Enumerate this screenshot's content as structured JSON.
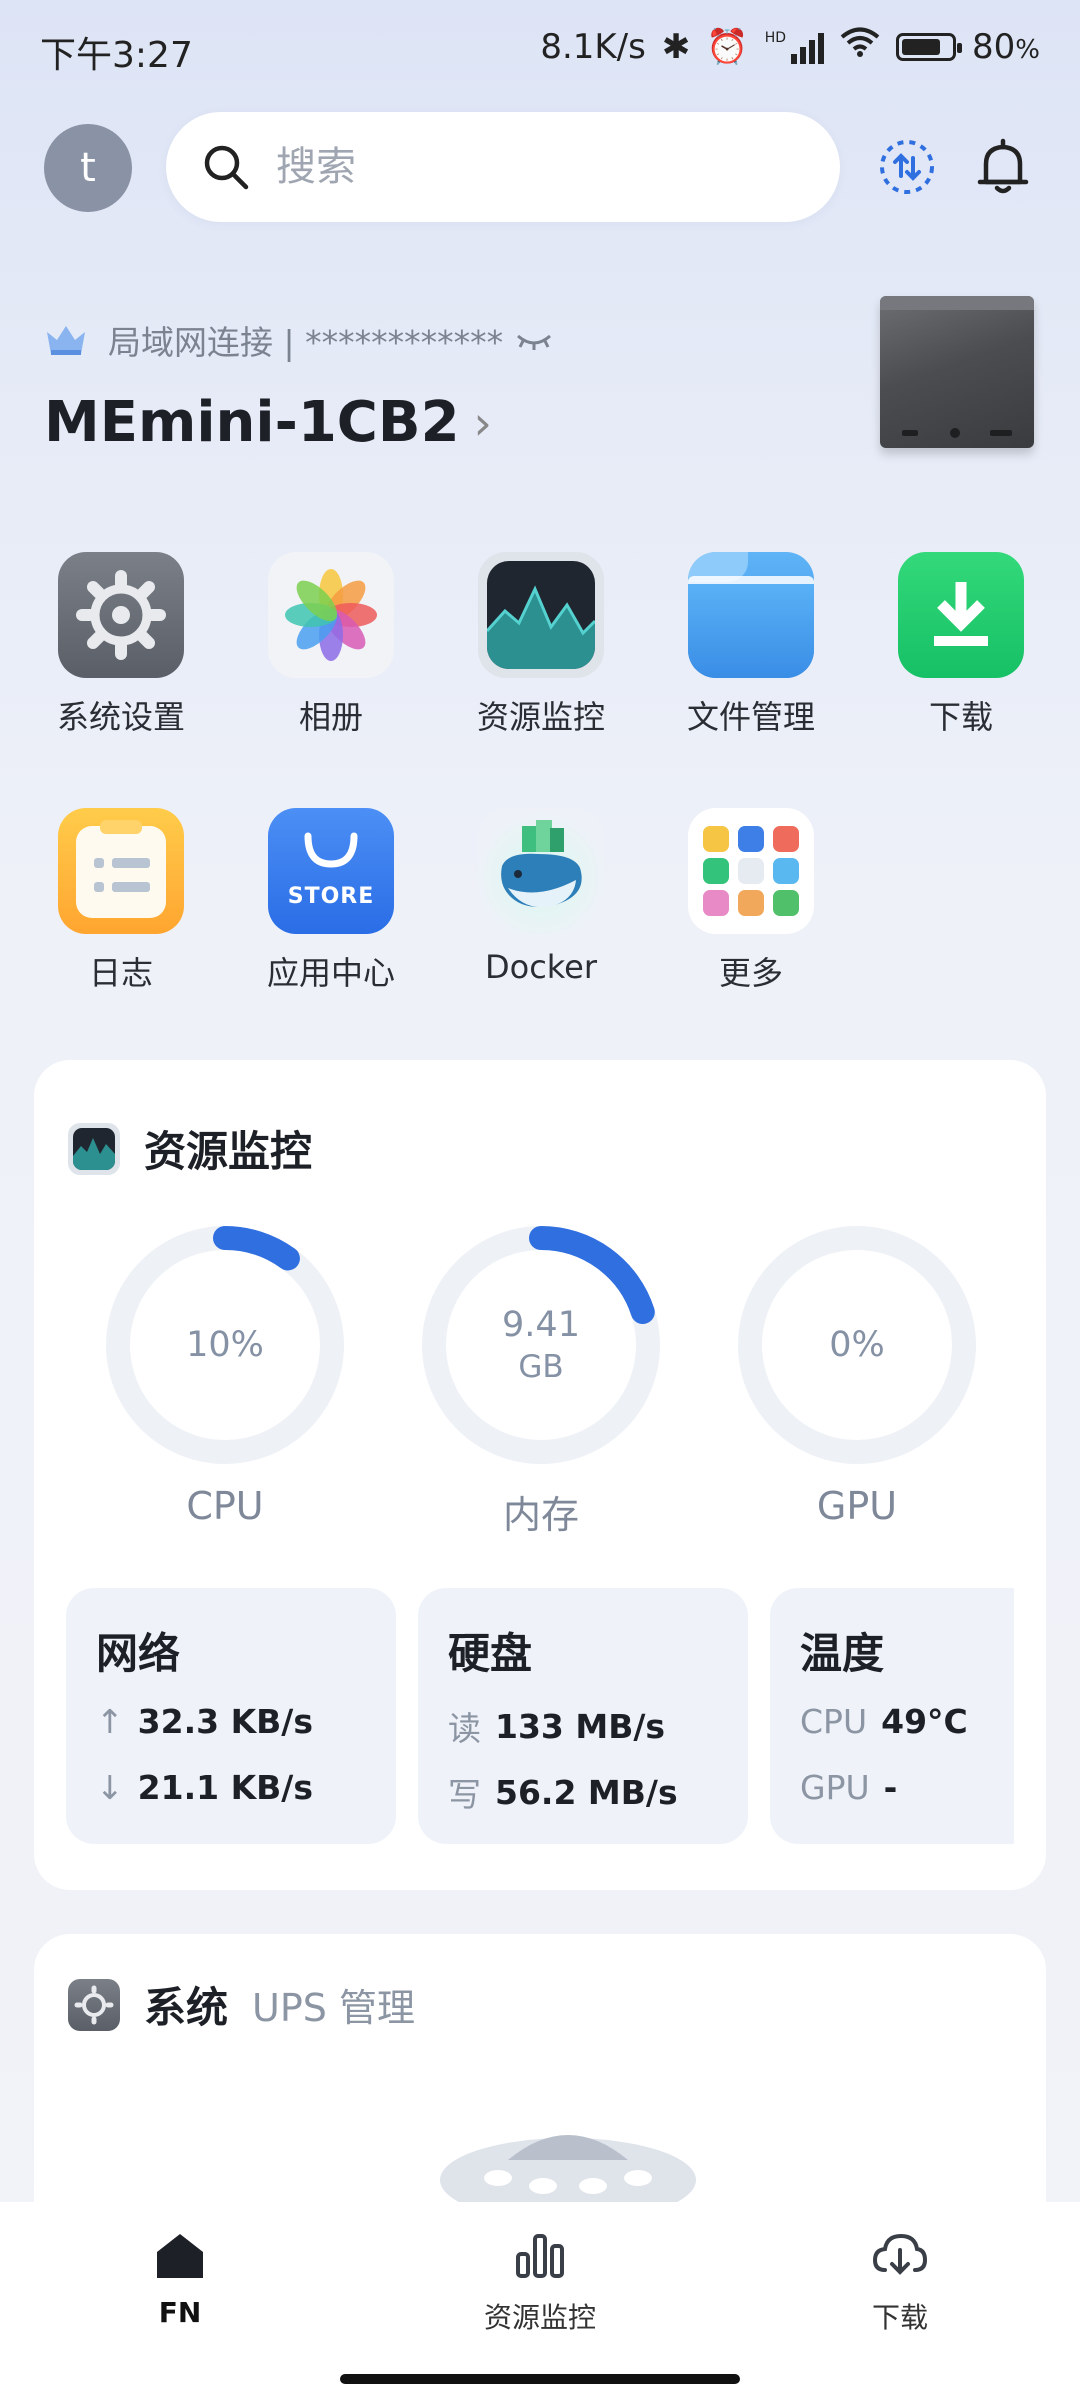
{
  "status_bar": {
    "time": "下午3:27",
    "net_speed": "8.1K/s",
    "signal": "HD",
    "battery_percent": "80",
    "battery_level": 0.8
  },
  "header": {
    "avatar_letter": "t",
    "search_placeholder": "搜索"
  },
  "device": {
    "connection": "局域网连接 | ************",
    "name": "MEmini-1CB2"
  },
  "apps": [
    {
      "label": "系统设置",
      "icon": "gear-icon"
    },
    {
      "label": "相册",
      "icon": "photos-icon"
    },
    {
      "label": "资源监控",
      "icon": "monitor-icon"
    },
    {
      "label": "文件管理",
      "icon": "folder-icon"
    },
    {
      "label": "下载",
      "icon": "download-icon"
    },
    {
      "label": "日志",
      "icon": "log-icon"
    },
    {
      "label": "应用中心",
      "icon": "store-icon",
      "badge": "STORE"
    },
    {
      "label": "Docker",
      "icon": "docker-icon"
    },
    {
      "label": "更多",
      "icon": "more-apps-icon"
    }
  ],
  "resource": {
    "title": "资源监控",
    "cpu": {
      "label": "CPU",
      "value": "10%",
      "fraction": 0.1
    },
    "mem": {
      "label": "内存",
      "value": "9.41",
      "unit": "GB",
      "fraction": 0.2
    },
    "gpu": {
      "label": "GPU",
      "value": "0%",
      "fraction": 0.0
    },
    "network": {
      "title": "网络",
      "up": "32.3 KB/s",
      "down": "21.1 KB/s"
    },
    "disk": {
      "title": "硬盘",
      "read_label": "读",
      "read": "133 MB/s",
      "write_label": "写",
      "write": "56.2 MB/s"
    },
    "temp": {
      "title": "温度",
      "cpu_label": "CPU",
      "cpu": "49°C",
      "gpu_label": "GPU",
      "gpu": "-"
    }
  },
  "system": {
    "title": "系统",
    "ups": "UPS 管理"
  },
  "nav": {
    "home": "FN",
    "monitor": "资源监控",
    "download": "下载"
  },
  "colors": {
    "accent": "#2f6fe0",
    "gauge_track": "#eef1f6"
  }
}
